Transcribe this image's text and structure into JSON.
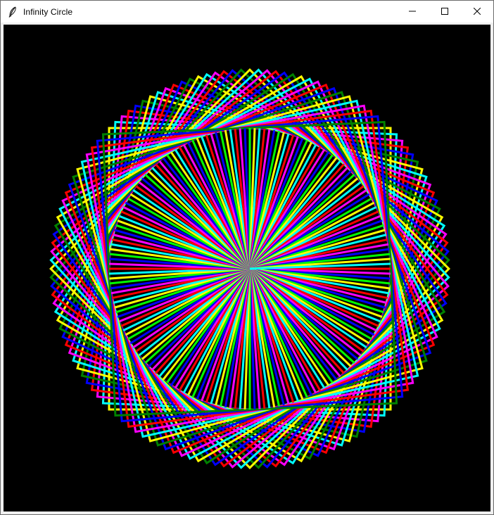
{
  "window": {
    "title": "Infinity Circle",
    "app_icon": "feather-icon",
    "controls": {
      "minimize": "minimize-icon",
      "maximize": "maximize-icon",
      "close": "close-icon"
    }
  },
  "canvas": {
    "background": "#000000",
    "pen_colors": [
      "#ff0000",
      "#ff00ff",
      "#0000ff",
      "#00ff00",
      "#ffff00",
      "#00ffff"
    ],
    "square_colors": [
      "#ffff00",
      "#00ffff",
      "#ff00ff",
      "#ff0000",
      "#0000ff",
      "#008000"
    ],
    "square_count": 36,
    "ray_count": 180
  }
}
